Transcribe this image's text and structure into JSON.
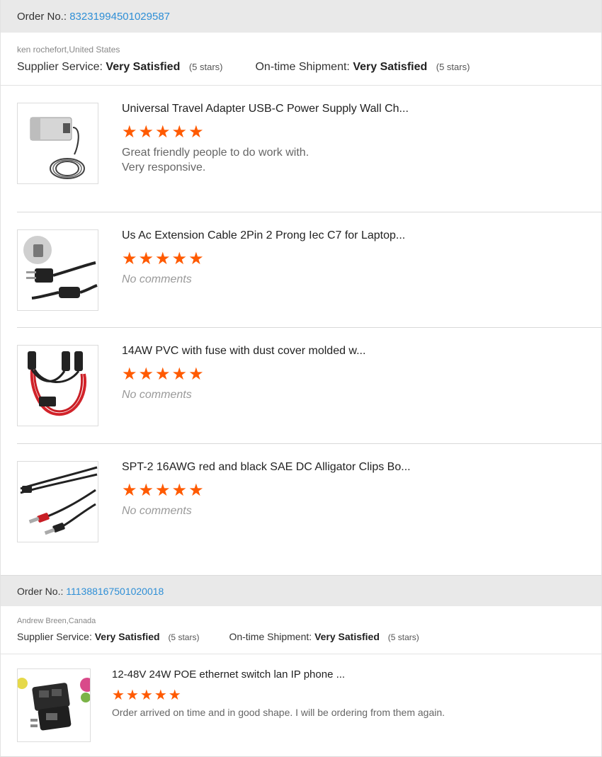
{
  "orders": [
    {
      "order_label": "Order No.:",
      "order_number": "83231994501029587",
      "buyer": "ken rochefort,United States",
      "supplier_service_label": "Supplier Service:",
      "supplier_service_value": "Very Satisfied",
      "supplier_service_stars": "(5 stars)",
      "shipment_label": "On-time Shipment:",
      "shipment_value": "Very Satisfied",
      "shipment_stars": "(5 stars)",
      "items": [
        {
          "title": "Universal Travel Adapter USB-C Power Supply Wall Ch...",
          "rating": 5,
          "comment_line1": "Great friendly people to do work with.",
          "comment_line2": "Very responsive.",
          "image_icon": "power-adapter-image"
        },
        {
          "title": "Us Ac Extension Cable 2Pin 2 Prong Iec C7 for Laptop...",
          "rating": 5,
          "comment_line1": "No comments",
          "image_icon": "power-cord-image"
        },
        {
          "title": "14AW PVC with fuse with dust cover molded w...",
          "rating": 5,
          "comment_line1": "No comments",
          "image_icon": "fused-cable-image"
        },
        {
          "title": "SPT-2 16AWG red and black SAE DC Alligator Clips Bo...",
          "rating": 5,
          "comment_line1": "No comments",
          "image_icon": "alligator-clips-image"
        }
      ]
    },
    {
      "order_label": "Order No.:",
      "order_number": "111388167501020018",
      "buyer": "Andrew Breen,Canada",
      "supplier_service_label": "Supplier Service:",
      "supplier_service_value": "Very Satisfied",
      "supplier_service_stars": "(5 stars)",
      "shipment_label": "On-time Shipment:",
      "shipment_value": "Very Satisfied",
      "shipment_stars": "(5 stars)",
      "items": [
        {
          "title": "12-48V 24W POE ethernet switch lan IP phone ...",
          "rating": 5,
          "comment_line1": "Order arrived on time and in good shape. I will be ordering from them again.",
          "image_icon": "poe-adapter-image"
        }
      ]
    }
  ],
  "colors": {
    "star": "#ff5a00",
    "order_number": "#2f8fd6",
    "header_bg": "#e9e9e9"
  }
}
